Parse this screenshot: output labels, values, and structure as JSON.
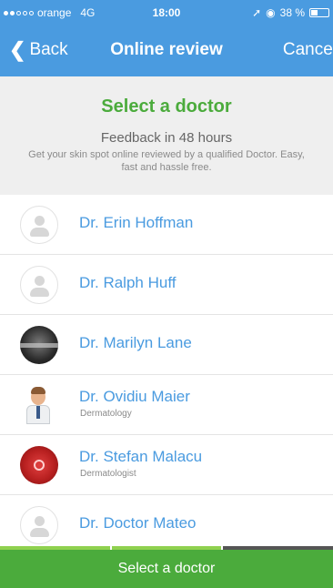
{
  "status_bar": {
    "carrier": "orange",
    "network": "4G",
    "time": "18:00",
    "battery": "38 %",
    "signal_bars_filled": 2,
    "signal_bars_total": 5,
    "battery_level": 0.38
  },
  "nav": {
    "back_label": "Back",
    "title": "Online review",
    "cancel_label": "Cancel"
  },
  "header": {
    "title": "Select a doctor",
    "subtitle": "Feedback in 48 hours",
    "description": "Get your skin spot online reviewed by a qualified Doctor. Easy, fast and hassle free."
  },
  "doctors": [
    {
      "name": "Dr. Erin Hoffman",
      "specialty": "",
      "avatar": "placeholder-user-icon"
    },
    {
      "name": "Dr. Ralph Huff",
      "specialty": "",
      "avatar": "placeholder-user-icon"
    },
    {
      "name": "Dr. Marilyn Lane",
      "specialty": "",
      "avatar": "dark-logo-photo"
    },
    {
      "name": "Dr. Ovidiu Maier",
      "specialty": "Dermatology",
      "avatar": "doctor-photo"
    },
    {
      "name": "Dr. Stefan Malacu",
      "specialty": "Dermatologist",
      "avatar": "red-logo-photo"
    },
    {
      "name": "Dr. Doctor Mateo",
      "specialty": "",
      "avatar": "placeholder-user-icon"
    }
  ],
  "progress": {
    "steps_total": 3,
    "steps_done": 2
  },
  "footer": {
    "button_label": "Select a doctor"
  },
  "colors": {
    "primary_blue": "#4a9be0",
    "accent_green": "#4bab3c",
    "progress_green": "#8fd14f"
  }
}
